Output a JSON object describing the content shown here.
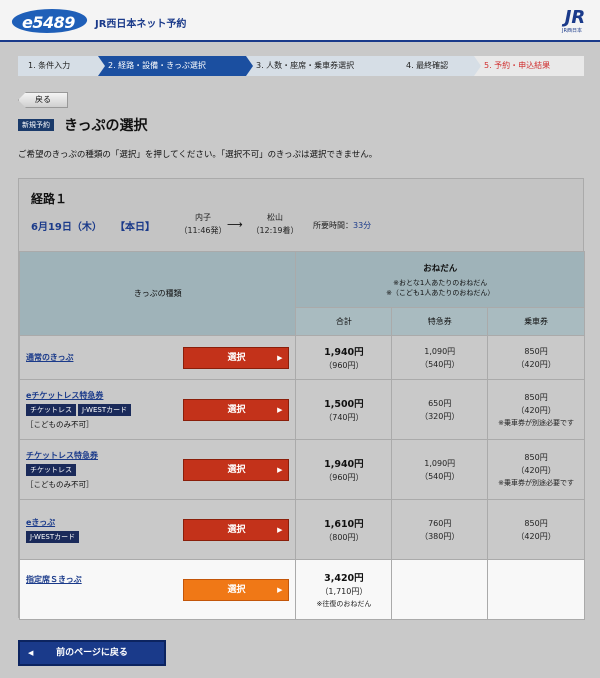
{
  "header": {
    "logo": "e5489",
    "site_name": "JR西日本ネット予約",
    "jr_logo": "JR",
    "jr_logo_sub": "JR西日本"
  },
  "steps": [
    {
      "label": "1. 条件入力",
      "state": "done"
    },
    {
      "label": "2. 経路・設備・きっぷ選択",
      "state": "active"
    },
    {
      "label": "3. 人数・座席・乗車券選択",
      "state": "todo"
    },
    {
      "label": "4. 最終確認",
      "state": "todo"
    },
    {
      "label": "5. 予約・申込結果",
      "state": "todo"
    }
  ],
  "back_button": "戻る",
  "badge_new": "新規予約",
  "page_title": "きっぷの選択",
  "instruction": "ご希望のきっぷの種類の「選択」を押してください。「選択不可」のきっぷは選択できません。",
  "route": {
    "title": "経路１",
    "date": "6月19日（木）",
    "day_type": "【本日】",
    "from_station": "内子",
    "from_time": "（11:46発）",
    "arrow": "⟶",
    "to_station": "松山",
    "to_time": "（12:19着）",
    "duration_label": "所要時間：",
    "duration_value": "33分"
  },
  "table": {
    "col_ticket_type": "きっぷの種類",
    "col_price": "おねだん",
    "price_note1": "※おとな1人あたりのおねだん",
    "price_note2": "※（こども1人あたりのおねだん）",
    "col_total": "合計",
    "col_express": "特急券",
    "col_fare": "乗車券",
    "select_label": "選択",
    "rows": [
      {
        "name": "通常のきっぷ",
        "tags": [],
        "note": "",
        "total": "1,940円",
        "total_child": "（960円）",
        "express": "1,090円",
        "express_child": "（540円）",
        "fare": "850円",
        "fare_child": "（420円）",
        "fare_warn": ""
      },
      {
        "name": "eチケットレス特急券",
        "tags": [
          "チケットレス",
          "J-WESTカード"
        ],
        "note": "［こどものみ不可］",
        "total": "1,500円",
        "total_child": "（740円）",
        "express": "650円",
        "express_child": "（320円）",
        "fare": "850円",
        "fare_child": "（420円）",
        "fare_warn": "※乗車券が別途必要です"
      },
      {
        "name": "チケットレス特急券",
        "tags": [
          "チケットレス"
        ],
        "note": "［こどものみ不可］",
        "total": "1,940円",
        "total_child": "（960円）",
        "express": "1,090円",
        "express_child": "（540円）",
        "fare": "850円",
        "fare_child": "（420円）",
        "fare_warn": "※乗車券が別途必要です"
      },
      {
        "name": "eきっぷ",
        "tags": [
          "J-WESTカード"
        ],
        "note": "",
        "total": "1,610円",
        "total_child": "（800円）",
        "express": "760円",
        "express_child": "（380円）",
        "fare": "850円",
        "fare_child": "（420円）",
        "fare_warn": ""
      },
      {
        "name": "指定席Ｓきっぷ",
        "tags": [],
        "note": "",
        "total": "3,420円",
        "total_child": "（1,710円）",
        "total_note": "※往復のおねだん",
        "express": "",
        "express_child": "",
        "fare": "",
        "fare_child": "",
        "fare_warn": ""
      }
    ]
  },
  "prev_button": "前のページに戻る",
  "colors": {
    "brand": "#1a3a8a",
    "select_red": "#c3321a",
    "select_orange": "#f07816"
  }
}
